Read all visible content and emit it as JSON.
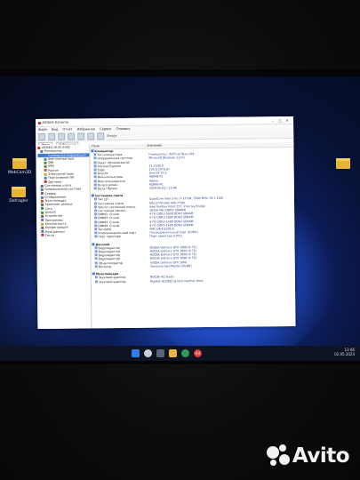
{
  "desktop": {
    "icons": [
      {
        "label": "WebCam3D"
      },
      {
        "label": "Defragler"
      }
    ]
  },
  "window": {
    "title": "AIDA64 Extreme",
    "menu": [
      "Файл",
      "Вид",
      "Отчёт",
      "Избранное",
      "Сервис",
      "Справка"
    ],
    "toolbar_labels": [
      "Отчёт"
    ],
    "tabs": [
      "Меню",
      "Избранное"
    ],
    "tree": [
      {
        "label": "AIDA64 v6.85.6300",
        "color": "#c33"
      },
      {
        "label": "Компьютер",
        "color": "#4a7fc8"
      },
      {
        "label": "Суммарная информация",
        "color": "#4a7fc8",
        "selected": true
      },
      {
        "label": "Имя компьютера",
        "color": "#4a7fc8"
      },
      {
        "label": "DMI",
        "color": "#5a8a3a"
      },
      {
        "label": "IPMI",
        "color": "#5a8a3a"
      },
      {
        "label": "Разгон",
        "color": "#c85a2a"
      },
      {
        "label": "Электропитание",
        "color": "#d8a030"
      },
      {
        "label": "Портативные ПК",
        "color": "#4a7fc8"
      },
      {
        "label": "Датчики",
        "color": "#c33"
      },
      {
        "label": "Системная плата",
        "color": "#6a6a6a"
      },
      {
        "label": "Операционная система",
        "color": "#4a7fc8"
      },
      {
        "label": "Сервер",
        "color": "#6a6a6a"
      },
      {
        "label": "Отображение",
        "color": "#4a7fc8"
      },
      {
        "label": "Мультимедиа",
        "color": "#c85a2a"
      },
      {
        "label": "Хранение данных",
        "color": "#6a6a6a"
      },
      {
        "label": "Сеть",
        "color": "#3a8a5a"
      },
      {
        "label": "DirectX",
        "color": "#5a8a3a"
      },
      {
        "label": "Устройства",
        "color": "#6a6a6a"
      },
      {
        "label": "Программы",
        "color": "#4a7fc8"
      },
      {
        "label": "Безопасность",
        "color": "#d8a030"
      },
      {
        "label": "Конфигурация",
        "color": "#6a6a6a"
      },
      {
        "label": "База данных",
        "color": "#4a7fc8"
      },
      {
        "label": "Тесты",
        "color": "#c33"
      }
    ],
    "columns": [
      "Поле",
      "Значение"
    ],
    "rows": [
      {
        "type": "group",
        "f": "Компьютер",
        "v": ""
      },
      {
        "f": "Тип компьютера",
        "v": "Компьютер с ACPI на базе x64"
      },
      {
        "f": "Операционная система",
        "v": "Microsoft Windows 11 Pro"
      },
      {
        "f": "Пакет обновления ОС",
        "v": "-"
      },
      {
        "f": "Internet Explorer",
        "v": "11.2200.0"
      },
      {
        "f": "Edge",
        "v": "124.0.2478.67"
      },
      {
        "f": "DirectX",
        "v": "DirectX 12.0"
      },
      {
        "f": "Имя компьютера",
        "v": "ADMIN-PC"
      },
      {
        "f": "Имя пользователя",
        "v": "Admin"
      },
      {
        "f": "Вход в домен",
        "v": "ADMIN-PC"
      },
      {
        "f": "Дата / Время",
        "v": "2024-05-02 / 13:46"
      },
      {
        "type": "blank",
        "f": "",
        "v": ""
      },
      {
        "type": "group",
        "f": "Системная плата",
        "v": ""
      },
      {
        "f": "Тип ЦП",
        "v": "QuadCore Intel Core i7-3770K, 3500 MHz (35 x 100)"
      },
      {
        "f": "Системная плата",
        "v": "MSI Z77A-G43 (MS-7758)"
      },
      {
        "f": "Чипсет системной платы",
        "v": "Intel Panther Point Z77, Intel Ivy Bridge"
      },
      {
        "f": "Системная память",
        "v": "16326 МБ (DDR3 SDRAM)"
      },
      {
        "f": "DIMM1: Crucial",
        "v": "4 ГБ DDR3-1600 DDR3 SDRAM"
      },
      {
        "f": "DIMM2: Crucial",
        "v": "4 ГБ DDR3-1600 DDR3 SDRAM"
      },
      {
        "f": "DIMM3: Crucial",
        "v": "4 ГБ DDR3-1600 DDR3 SDRAM"
      },
      {
        "f": "DIMM4: Crucial",
        "v": "4 ГБ DDR3-1600 DDR3 SDRAM"
      },
      {
        "f": "Тип BIOS",
        "v": "AMI (04/10/2013)"
      },
      {
        "f": "Коммуникационный порт",
        "v": "Последовательный порт (COM1)"
      },
      {
        "f": "Порт принтера",
        "v": "Порт принтера (LPT1)"
      },
      {
        "type": "blank",
        "f": "",
        "v": ""
      },
      {
        "type": "group",
        "f": "Дисплей",
        "v": ""
      },
      {
        "f": "Видеоадаптер",
        "v": "NVIDIA GeForce GTX 1060 (6 ГБ)"
      },
      {
        "f": "Видеоадаптер",
        "v": "NVIDIA GeForce GTX 1060 (6 ГБ)"
      },
      {
        "f": "Видеоадаптер",
        "v": "NVIDIA GeForce GTX 1060 (6 ГБ)"
      },
      {
        "f": "Видеоадаптер",
        "v": "NVIDIA GeForce GTX 1060 (6 ГБ)"
      },
      {
        "f": "3D-акселератор",
        "v": "nVIDIA GeForce GTX 1060"
      },
      {
        "f": "Монитор",
        "v": "Samsung SyncMaster [NoDB]"
      },
      {
        "type": "blank",
        "f": "",
        "v": ""
      },
      {
        "type": "group",
        "f": "Мультимедиа",
        "v": ""
      },
      {
        "f": "Звуковой адаптер",
        "v": "NVIDIA HD Audio"
      },
      {
        "f": "Звуковой адаптер",
        "v": "Realtek ALC892 @ Intel Panther Point"
      }
    ]
  },
  "taskbar": {
    "time": "13:46",
    "date": "02.05.2024",
    "pinned_badge": "64"
  },
  "watermark": {
    "brand": "Avito"
  }
}
